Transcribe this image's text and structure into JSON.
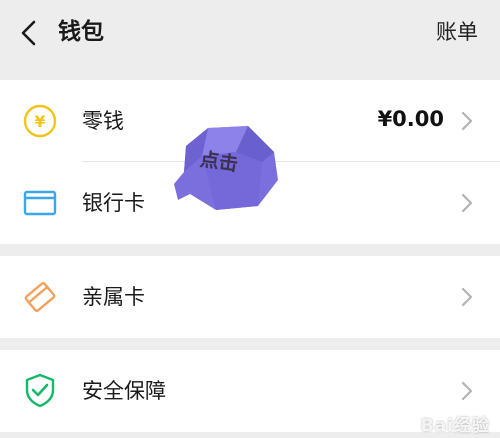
{
  "header": {
    "title": "钱包",
    "bill_link": "账单"
  },
  "rows": {
    "change": {
      "label": "零钱",
      "value": "¥0.00",
      "icon": "yen-coin-icon"
    },
    "bank_card": {
      "label": "银行卡",
      "icon": "bank-card-icon"
    },
    "family_card": {
      "label": "亲属卡",
      "icon": "family-card-icon"
    },
    "security": {
      "label": "安全保障",
      "icon": "shield-check-icon"
    }
  },
  "annotation": {
    "text": "点击"
  },
  "watermark": {
    "text": "Bai经验"
  },
  "colors": {
    "background": "#ededed",
    "card": "#ffffff",
    "yen_icon": "#f0c419",
    "bank_icon": "#3aa7e8",
    "family_icon": "#f2a25c",
    "shield_icon": "#14b86b",
    "tooltip": "#7b6fdd"
  }
}
